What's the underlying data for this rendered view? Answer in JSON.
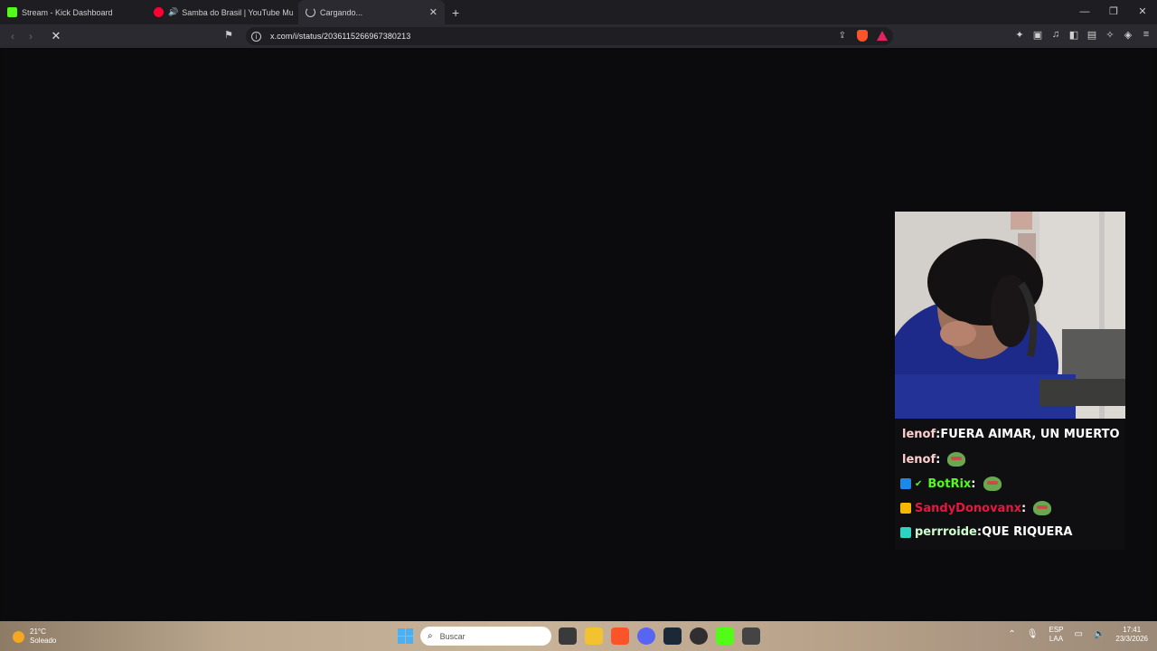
{
  "tabs": [
    {
      "title": "Stream - Kick Dashboard",
      "favicon_color": "#53fc18",
      "icon": "kick-icon"
    },
    {
      "title": "Samba do Brasil | YouTube Music",
      "favicon_color": "#ff0033",
      "icon": "youtube-music-icon",
      "audio": "🔊"
    },
    {
      "title": "Cargando...",
      "active": true,
      "icon": "loading-spinner-icon"
    }
  ],
  "new_tab": "+",
  "window_controls": [
    "—",
    "❐",
    "✕"
  ],
  "nav": {
    "back": "‹",
    "forward": "›",
    "stop": "✕"
  },
  "address": {
    "url": "x.com/i/status/2036115266967380213"
  },
  "chat": [
    {
      "user": "lenof",
      "sep": " : ",
      "text": "FUERA AIMAR, UN MUERTO",
      "color": "#ffd0d0",
      "badge": null
    },
    {
      "user": "lenof",
      "sep": " : ",
      "text": "",
      "color": "#ffd0d0",
      "emote": true
    },
    {
      "user": "BotRix",
      "sep": " : ",
      "text": "",
      "color": "#53fc18",
      "emote": true,
      "badge": "#1e88e5",
      "verified": "✔"
    },
    {
      "user": "SandyDonovanx",
      "sep": " : ",
      "text": "",
      "color": "#e8173f",
      "emote": true,
      "badge": "#f5b800"
    },
    {
      "user": "perrroide",
      "sep": " : ",
      "text": "QUE RIQUERA",
      "color": "#cfffd0",
      "badge": "#2dd4bf"
    }
  ],
  "taskbar": {
    "weather_temp": "21°C",
    "weather_desc": "Soleado",
    "search_placeholder": "Buscar",
    "lang_top": "ESP",
    "lang_bottom": "LAA",
    "time": "17:41",
    "date": "23/3/2026"
  }
}
